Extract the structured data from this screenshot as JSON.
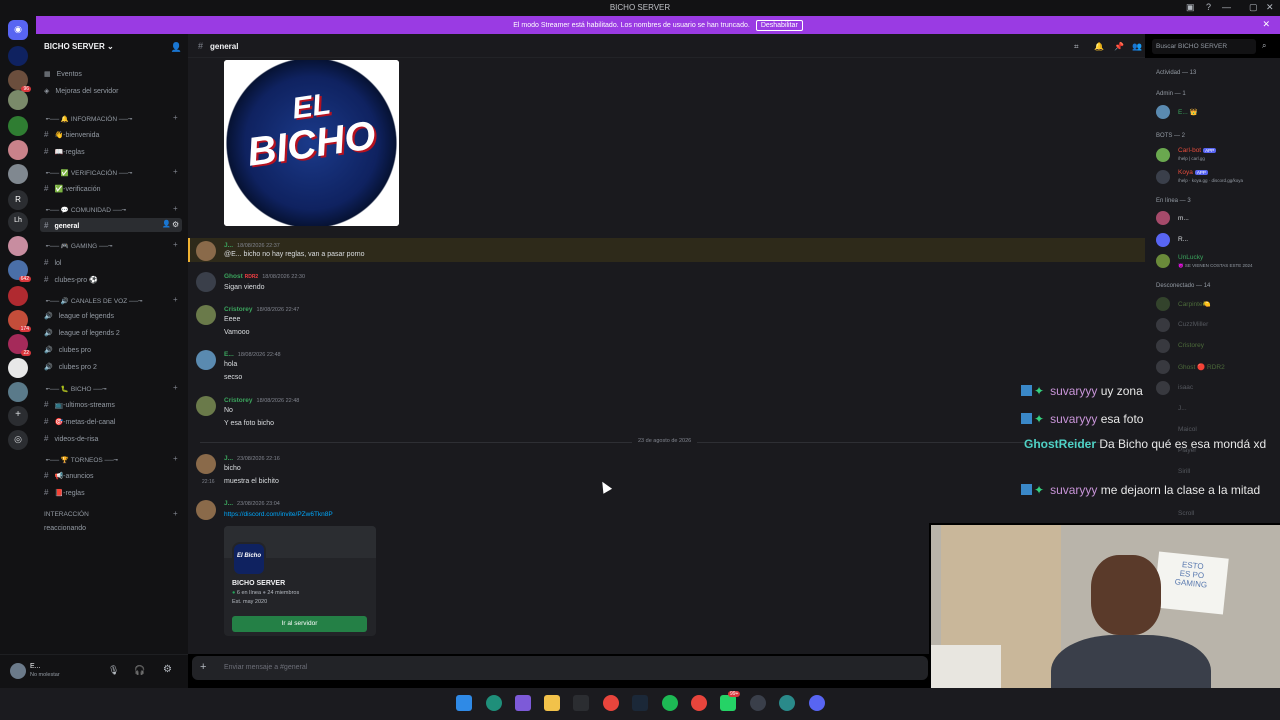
{
  "window": {
    "title": "BICHO SERVER"
  },
  "banner": {
    "text": "El modo Streamer está habilitado. Los nombres de usuario se han truncado.",
    "button": "Deshabilitar"
  },
  "guild_badges": [
    "96",
    "642",
    "174",
    "22"
  ],
  "server": {
    "name": "BICHO SERVER",
    "top_links": [
      "Eventos",
      "Mejoras del servidor"
    ],
    "categories": [
      {
        "name": "╾── 🔔 INFORMACIÓN ──╼",
        "channels": [
          "👋-bienvenida",
          "📖-reglas"
        ]
      },
      {
        "name": "╾── ✅ VERIFICACIÓN ──╼",
        "channels": [
          "✅-verificación"
        ]
      },
      {
        "name": "╾── 💬 COMUNIDAD ──╼",
        "channels": [
          "general"
        ]
      },
      {
        "name": "╾── 🎮 GAMING ──╼",
        "channels": [
          "lol",
          "clubes-pro ⚽"
        ]
      },
      {
        "name": "╾── 🔊 CANALES DE VOZ ──╼",
        "channels": [
          "league of legends",
          "league of legends 2",
          "clubes pro",
          "clubes pro 2"
        ]
      },
      {
        "name": "╾── 🐛 BICHO ──╼",
        "channels": [
          "📺-ultimos-streams",
          "🎯-metas-del-canal",
          "videos-de-risa"
        ]
      },
      {
        "name": "╾── 🏆 TORNEOS ──╼",
        "channels": [
          "📢-anuncios",
          "📕-reglas"
        ]
      },
      {
        "name": "INTERACCIÓN",
        "channels": [
          "reaccionando"
        ]
      }
    ]
  },
  "user": {
    "name": "E...",
    "status": "No molestar"
  },
  "channel": {
    "name": "general",
    "placeholder": "Enviar mensaje a #general"
  },
  "search": {
    "placeholder": "Buscar BICHO SERVER"
  },
  "logo_text": [
    "EL",
    "BICHO"
  ],
  "messages": [
    {
      "author": "J...",
      "time": "18/08/2026 22:37",
      "text": "@E... bicho no hay reglas, van a pasar porno",
      "color": "#3ba55d"
    },
    {
      "author": "Ghost",
      "tag": "RDR2",
      "time": "18/08/2026 22:30",
      "text": "Sigan viendo",
      "color": "#3ba55d"
    },
    {
      "author": "Cristorey",
      "time": "18/08/2026 22:47",
      "lines": [
        "Eeee",
        "Vamooo"
      ],
      "color": "#3ba55d"
    },
    {
      "author": "E...",
      "time": "18/08/2026 22:48",
      "lines": [
        "hola",
        "secso"
      ],
      "color": "#3ba55d"
    },
    {
      "author": "Cristorey",
      "time": "18/08/2026 22:48",
      "lines": [
        "No",
        "Y esa foto bicho"
      ],
      "color": "#3ba55d"
    },
    {
      "author": "J...",
      "time": "23/08/2026 22:16",
      "lines": [
        "bicho",
        "muestra el bichito"
      ],
      "side_time": "22:16",
      "color": "#3ba55d"
    },
    {
      "author": "J...",
      "time": "23/08/2026 23:04",
      "link": "https://discord.com/invite/PZw6Tkn8P",
      "color": "#3ba55d"
    }
  ],
  "date_separator": "23 de agosto de 2026",
  "invite": {
    "name": "BICHO SERVER",
    "online": "6 en línea",
    "members": "24 miembros",
    "est": "Est. may 2020",
    "button": "Ir al servidor",
    "icon_text": "El Bicho"
  },
  "member_list": {
    "activity": "Actividad — 13",
    "groups": [
      {
        "label": "Admin — 1",
        "members": [
          {
            "name": "E... 👑",
            "color": "#3ba55d"
          }
        ]
      },
      {
        "label": "BOTS — 2",
        "members": [
          {
            "name": "Carl-bot",
            "app": "APP",
            "sub": "/help | carl.gg",
            "color": "#e74c3c"
          },
          {
            "name": "Koya",
            "app": "APP",
            "sub": "/help · koya.gg · discord.gg/koya",
            "color": "#e74c3c"
          }
        ]
      },
      {
        "label": "En línea — 3",
        "members": [
          {
            "name": "m...",
            "color": "#dbdee1"
          },
          {
            "name": "R...",
            "color": "#dbdee1"
          },
          {
            "name": "UnLucky",
            "sub": "😈 SE VIENEN COSTAS ESTE 2024",
            "color": "#3ba55d"
          }
        ]
      },
      {
        "label": "Desconectado — 14",
        "members": [
          {
            "name": "Carpinte🍋",
            "color": "#4c6b3a"
          },
          {
            "name": "CuzzMiller",
            "color": "#55585f"
          },
          {
            "name": "Cristorey",
            "color": "#4c6b3a"
          },
          {
            "name": "Ghost 🔴 RDR2",
            "color": "#4c6b3a"
          },
          {
            "name": "isaac",
            "color": "#55585f"
          },
          {
            "name": "J...",
            "color": "#55585f"
          },
          {
            "name": "Maicol",
            "color": "#55585f"
          },
          {
            "name": "Player",
            "color": "#55585f"
          },
          {
            "name": "Sirill",
            "color": "#55585f"
          },
          {
            "name": "Scroll",
            "color": "#55585f"
          }
        ]
      }
    ]
  },
  "stream_chat": [
    {
      "user": "suvaryyy",
      "text": "uy zona",
      "color": "#c894d8"
    },
    {
      "user": "suvaryyy",
      "text": "esa foto",
      "color": "#c894d8"
    },
    {
      "user": "GhostReider",
      "text": "Da Bicho qué es esa mondá xd",
      "color": "#4fd1c5"
    },
    {
      "user": "suvaryyy",
      "text": "me dejaorn la clase a la mitad",
      "color": "#c894d8"
    }
  ],
  "webcam_sign": [
    "ESTO",
    "ES PO",
    "GAMING"
  ],
  "taskbar_badge": "99+"
}
